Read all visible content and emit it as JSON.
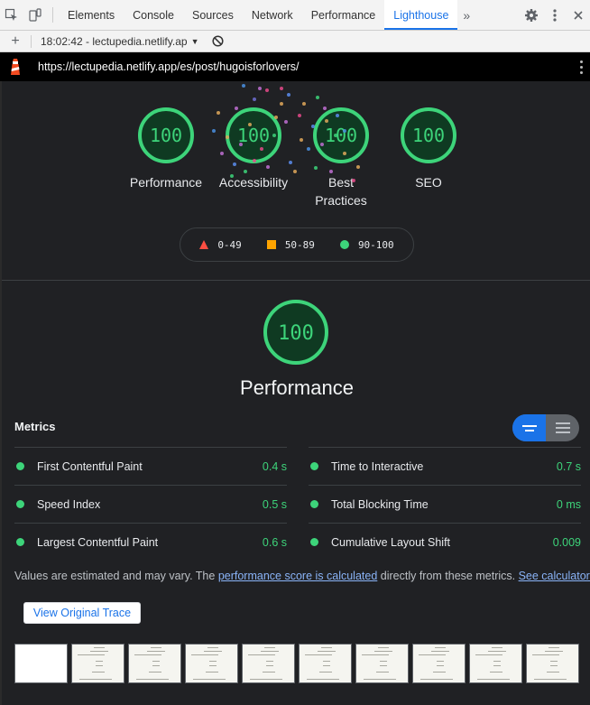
{
  "devtools": {
    "tabs": [
      "Elements",
      "Console",
      "Sources",
      "Network",
      "Performance",
      "Lighthouse"
    ],
    "active_tab": "Lighthouse",
    "more_label": "»"
  },
  "report_bar": {
    "selected_report": "18:02:42 - lectupedia.netlify.ap",
    "add_icon": "plus-icon",
    "clear_icon": "block-icon"
  },
  "topbar": {
    "url": "https://lectupedia.netlify.app/es/post/hugoisforlovers/"
  },
  "gauges": [
    {
      "score": "100",
      "label": "Performance"
    },
    {
      "score": "100",
      "label": "Accessibility"
    },
    {
      "score": "100",
      "label": "Best Practices"
    },
    {
      "score": "100",
      "label": "SEO"
    }
  ],
  "legend": {
    "fail": "0-49",
    "average": "50-89",
    "pass": "90-100"
  },
  "performance": {
    "score": "100",
    "title": "Performance",
    "score_fraction": 1.0
  },
  "metrics": {
    "header": "Metrics",
    "left": [
      {
        "name": "First Contentful Paint",
        "value": "0.4 s"
      },
      {
        "name": "Speed Index",
        "value": "0.5 s"
      },
      {
        "name": "Largest Contentful Paint",
        "value": "0.6 s"
      }
    ],
    "right": [
      {
        "name": "Time to Interactive",
        "value": "0.7 s"
      },
      {
        "name": "Total Blocking Time",
        "value": "0 ms"
      },
      {
        "name": "Cumulative Layout Shift",
        "value": "0.009"
      }
    ]
  },
  "note": {
    "prefix": "Values are estimated and may vary. The ",
    "link1": "performance score is calculated",
    "middle": " directly from these metrics. ",
    "link2": "See calculator."
  },
  "trace_button": "View Original Trace",
  "colors": {
    "pass": "#3dd47a",
    "average": "#ffa400",
    "fail": "#ff4e42",
    "accent": "#1a73e8"
  }
}
